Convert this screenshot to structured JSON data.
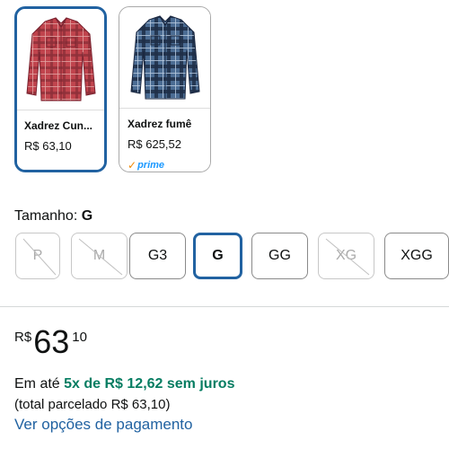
{
  "variants": [
    {
      "name": "Xadrez Cun...",
      "price": "R$ 63,10",
      "selected": true,
      "image": "red-plaid-shirt"
    },
    {
      "name": "Xadrez fumê",
      "price": "R$ 625,52",
      "selected": false,
      "prime": "prime",
      "image": "blue-plaid-shirt"
    }
  ],
  "size": {
    "label": "Tamanho: ",
    "selected_value": "G",
    "options": [
      {
        "label": "P",
        "available": false
      },
      {
        "label": "M",
        "available": false
      },
      {
        "label": "G3",
        "available": true
      },
      {
        "label": "G",
        "available": true,
        "selected": true
      },
      {
        "label": "GG",
        "available": true
      },
      {
        "label": "XG",
        "available": false
      },
      {
        "label": "XGG",
        "available": true
      }
    ]
  },
  "price": {
    "symbol": "R$",
    "whole": "63",
    "fraction": "10"
  },
  "installments": {
    "prefix": "Em até ",
    "highlight": "5x de R$ 12,62 sem juros",
    "total": "(total parcelado R$ 63,10)",
    "link": "Ver opções de pagamento"
  },
  "colors": {
    "selected_border": "#2162a1",
    "installment_green": "#067d62",
    "link_blue": "#2162a1",
    "prime_blue": "#1a98ff",
    "prime_check": "#f08804",
    "red_plaid": "#c0444d",
    "blue_plaid": "#3d5f86"
  }
}
